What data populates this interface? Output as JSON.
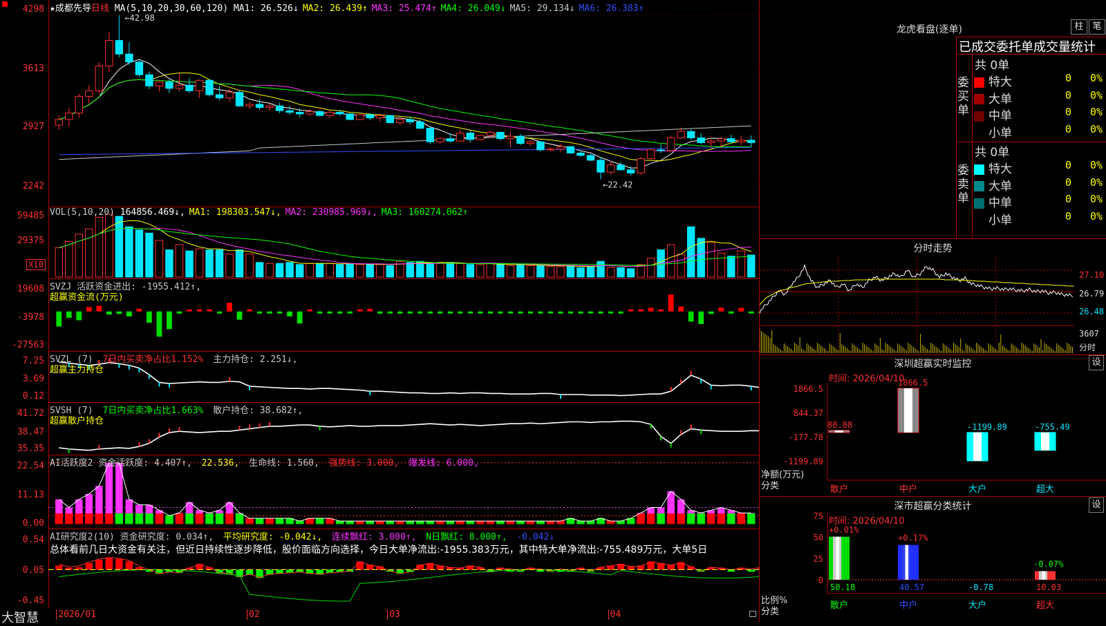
{
  "app": {
    "logo_text": "大智慧"
  },
  "main": {
    "header": {
      "star": "★",
      "stock": "成都先导",
      "period": "日线",
      "ma_label": "MA(5,10,20,30,60,120)",
      "ma": [
        {
          "label": "MA1: 26.526↓",
          "color": "#ffffff"
        },
        {
          "label": "MA2: 26.439↑",
          "color": "#ffff00"
        },
        {
          "label": "MA3: 25.474↑",
          "color": "#ff33ff"
        },
        {
          "label": "MA4: 26.049↓",
          "color": "#00ff00"
        },
        {
          "label": "MA5: 29.134↓",
          "color": "#c8c8c8"
        },
        {
          "label": "MA6: 26.383↑",
          "color": "#3050ff"
        }
      ]
    },
    "y_labels": [
      "4298",
      "3613",
      "2927",
      "2242"
    ],
    "high_label": "←42.98",
    "low_label": "←22.42",
    "candles": [
      [
        29.2,
        30.4,
        28.6,
        29.9
      ],
      [
        29.9,
        31.4,
        29.0,
        30.7
      ],
      [
        30.7,
        33.1,
        30.1,
        32.8
      ],
      [
        32.8,
        34.2,
        31.8,
        33.5
      ],
      [
        33.5,
        37.1,
        33.2,
        36.6
      ],
      [
        36.6,
        40.9,
        35.9,
        39.8
      ],
      [
        39.8,
        42.98,
        37.7,
        38.1
      ],
      [
        38.1,
        39.6,
        36.7,
        37.1
      ],
      [
        37.1,
        37.3,
        35.2,
        35.5
      ],
      [
        35.5,
        35.9,
        33.7,
        34.1
      ],
      [
        34.1,
        34.8,
        33.4,
        34.6
      ],
      [
        34.6,
        34.9,
        33.2,
        33.8
      ],
      [
        33.8,
        35.6,
        33.4,
        34.2
      ],
      [
        34.2,
        35.1,
        33.2,
        33.5
      ],
      [
        33.5,
        34.9,
        32.6,
        34.8
      ],
      [
        34.8,
        35.0,
        32.8,
        33.0
      ],
      [
        33.0,
        34.1,
        32.3,
        32.6
      ],
      [
        32.6,
        33.7,
        32.1,
        33.3
      ],
      [
        33.3,
        33.6,
        31.5,
        31.6
      ],
      [
        31.6,
        32.1,
        31.2,
        31.8
      ],
      [
        31.8,
        32.4,
        31.1,
        31.4
      ],
      [
        31.4,
        31.9,
        31.0,
        31.6
      ],
      [
        31.6,
        32.0,
        30.7,
        31.0
      ],
      [
        31.0,
        31.6,
        30.5,
        30.8
      ],
      [
        30.8,
        31.3,
        30.2,
        30.6
      ],
      [
        30.6,
        31.2,
        30.3,
        30.9
      ],
      [
        30.9,
        31.0,
        30.3,
        30.4
      ],
      [
        30.4,
        31.0,
        30.1,
        30.8
      ],
      [
        30.8,
        31.1,
        30.4,
        30.6
      ],
      [
        30.6,
        30.7,
        29.8,
        29.9
      ],
      [
        29.9,
        30.6,
        29.8,
        30.5
      ],
      [
        30.5,
        30.7,
        29.8,
        30.1
      ],
      [
        30.1,
        30.6,
        29.6,
        30.4
      ],
      [
        30.4,
        30.5,
        29.4,
        29.5
      ],
      [
        29.5,
        30.2,
        29.2,
        29.9
      ],
      [
        29.9,
        30.3,
        29.3,
        29.6
      ],
      [
        29.6,
        29.9,
        28.7,
        28.8
      ],
      [
        28.8,
        29.0,
        26.8,
        27.1
      ],
      [
        27.1,
        27.7,
        26.8,
        27.5
      ],
      [
        27.5,
        28.2,
        27.0,
        27.2
      ],
      [
        27.2,
        28.6,
        27.1,
        28.2
      ],
      [
        28.2,
        28.5,
        27.0,
        27.4
      ],
      [
        27.4,
        28.0,
        27.2,
        27.9
      ],
      [
        27.9,
        28.5,
        27.6,
        28.3
      ],
      [
        28.3,
        28.4,
        27.3,
        27.5
      ],
      [
        27.5,
        28.4,
        26.4,
        27.8
      ],
      [
        27.8,
        28.1,
        26.7,
        26.9
      ],
      [
        26.9,
        27.3,
        26.6,
        27.1
      ],
      [
        27.1,
        27.2,
        25.9,
        26.1
      ],
      [
        26.1,
        26.4,
        25.9,
        26.2
      ],
      [
        26.2,
        26.9,
        25.8,
        26.5
      ],
      [
        26.5,
        26.6,
        25.6,
        25.7
      ],
      [
        25.7,
        26.0,
        25.2,
        25.4
      ],
      [
        25.4,
        25.6,
        24.7,
        24.8
      ],
      [
        24.8,
        25.2,
        22.42,
        23.3
      ],
      [
        23.3,
        24.7,
        23.0,
        24.2
      ],
      [
        24.2,
        24.6,
        23.5,
        23.6
      ],
      [
        23.6,
        24.0,
        22.9,
        23.2
      ],
      [
        23.2,
        25.2,
        23.0,
        25.0
      ],
      [
        25.0,
        26.3,
        24.9,
        26.1
      ],
      [
        26.1,
        26.8,
        25.7,
        26.0
      ],
      [
        26.0,
        27.9,
        25.9,
        27.6
      ],
      [
        27.6,
        28.9,
        27.5,
        28.4
      ],
      [
        28.4,
        28.7,
        27.3,
        27.6
      ],
      [
        27.6,
        28.2,
        26.8,
        27.0
      ],
      [
        27.0,
        27.6,
        26.4,
        27.2
      ],
      [
        27.2,
        27.7,
        26.3,
        27.5
      ],
      [
        27.5,
        28.0,
        26.9,
        27.1
      ],
      [
        27.1,
        27.9,
        26.6,
        27.3
      ],
      [
        27.3,
        27.9,
        26.5,
        27.0
      ]
    ],
    "x_labels": [
      {
        "text": "2026/01",
        "i": 0
      },
      {
        "text": "02",
        "i": 19
      },
      {
        "text": "03",
        "i": 33
      },
      {
        "text": "04",
        "i": 55
      }
    ]
  },
  "vol": {
    "header_prefix": "VOL(5,10,20)",
    "header": [
      {
        "label": "164856.469↓,",
        "color": "#ffffff"
      },
      {
        "label": "MA1: 198303.547↓,",
        "color": "#ffff00"
      },
      {
        "label": "MA2: 230985.969↓,",
        "color": "#ff33ff"
      },
      {
        "label": "MA3: 160274.062↑",
        "color": "#00ff00"
      }
    ],
    "y_labels": [
      "59485",
      "29375"
    ],
    "unit": "X10",
    "values": [
      28,
      34,
      41,
      46,
      57,
      60,
      58,
      48,
      45,
      42,
      35,
      26,
      31,
      25,
      27,
      26,
      26,
      22,
      26,
      22,
      14,
      13,
      13,
      14,
      12,
      13,
      13,
      13,
      12,
      13,
      12,
      12,
      12,
      11,
      15,
      14,
      15,
      13,
      13,
      14,
      13,
      12,
      12,
      13,
      12,
      11,
      12,
      11,
      11,
      10,
      10,
      11,
      9,
      10,
      15,
      9,
      9,
      8,
      12,
      18,
      26,
      31,
      22,
      48,
      37,
      33,
      23,
      20,
      25,
      21
    ]
  },
  "svzj": {
    "header": [
      {
        "label": "SVZJ  活跃资金进出: -1955.412↑,",
        "color": "#c8c8c8"
      }
    ],
    "subtitle": "超赢资金流(万元)",
    "y_labels": [
      "19608",
      "-3978",
      "-27563"
    ],
    "values": [
      -12000,
      -5000,
      -7000,
      3500,
      4500,
      -2500,
      -2000,
      -4000,
      2200,
      -9000,
      -20000,
      -14000,
      -1500,
      700,
      700,
      500,
      -300,
      7000,
      -6500,
      300,
      -800,
      -1500,
      -700,
      -4000,
      -9500,
      600,
      -600,
      -300,
      -500,
      -400,
      1700,
      2000,
      -1400,
      -700,
      -1100,
      -800,
      -800,
      -600,
      -600,
      -700,
      -800,
      -600,
      -700,
      -600,
      -500,
      -700,
      -500,
      -600,
      -600,
      -400,
      -600,
      -500,
      -600,
      -400,
      -500,
      -400,
      -300,
      700,
      1600,
      2900,
      700,
      13500,
      4000,
      -8000,
      -10000,
      -2000,
      3000,
      -1500,
      2800,
      -1200,
      -1500
    ]
  },
  "svzl": {
    "header": [
      {
        "label": "SVZL (7) ",
        "color": "#c8c8c8"
      },
      {
        "label": "7日内买卖净占比1.152%",
        "color": "#ff3030"
      },
      {
        "label": " 主力持仓: 2.251↓,",
        "color": "#c8c8c8"
      }
    ],
    "subtitle": "超赢主力持仓",
    "y_labels": [
      "7.25",
      "3.69",
      "0.12"
    ],
    "values": [
      6.9,
      6.7,
      6.5,
      6.3,
      6.5,
      6.8,
      6.6,
      6.3,
      5.8,
      4.6,
      3.2,
      3.0,
      3.1,
      3.2,
      3.3,
      3.2,
      3.2,
      3.4,
      3.3,
      2.5,
      2.4,
      2.3,
      2.2,
      2.1,
      2.1,
      2.0,
      2.1,
      2.1,
      2.0,
      1.9,
      1.8,
      1.6,
      1.6,
      1.5,
      1.4,
      1.3,
      1.3,
      1.2,
      1.2,
      1.3,
      1.2,
      1.3,
      1.3,
      1.2,
      1.2,
      1.1,
      1.1,
      1.1,
      1.2,
      1.2,
      1.0,
      1.0,
      1.0,
      0.9,
      0.9,
      0.9,
      0.8,
      0.9,
      1.0,
      1.1,
      1.1,
      1.6,
      3.0,
      4.5,
      3.8,
      2.7,
      2.6,
      2.7,
      2.7,
      2.5,
      2.25
    ]
  },
  "svsh": {
    "header": [
      {
        "label": "SVSH (7) ",
        "color": "#c8c8c8"
      },
      {
        "label": "7日内买卖净占比1.663%",
        "color": "#00ff00"
      },
      {
        "label": " 散户持仓: 38.682↑,",
        "color": "#c8c8c8"
      }
    ],
    "subtitle": "超赢散户持仓",
    "y_labels": [
      "41.72",
      "38.47",
      "35.35"
    ],
    "values": [
      36.0,
      35.8,
      35.7,
      35.6,
      35.8,
      35.9,
      36.0,
      35.9,
      36.2,
      36.7,
      37.7,
      38.4,
      38.6,
      38.5,
      38.4,
      38.5,
      38.6,
      38.6,
      38.8,
      39.0,
      39.2,
      39.4,
      39.4,
      39.5,
      39.6,
      39.6,
      39.4,
      39.3,
      39.4,
      39.5,
      39.4,
      39.4,
      39.5,
      39.5,
      39.5,
      39.6,
      39.7,
      39.8,
      39.7,
      39.6,
      39.7,
      39.6,
      39.5,
      39.6,
      39.7,
      39.8,
      39.8,
      39.9,
      39.8,
      39.9,
      40.0,
      40.1,
      40.1,
      40.0,
      40.1,
      40.1,
      40.2,
      40.2,
      40.1,
      39.7,
      37.8,
      36.7,
      38.1,
      39.0,
      38.8,
      38.7,
      38.6,
      38.6,
      38.6,
      38.7,
      38.68
    ]
  },
  "ai_active": {
    "header": [
      {
        "label": "AI活跃度2 资金活跃度: 4.407↑,",
        "color": "#c8c8c8"
      },
      {
        "label": " 22.536,",
        "color": "#ffff00"
      },
      {
        "label": " 生命线: 1.560,",
        "color": "#c8c8c8"
      },
      {
        "label": " 强势线: 3.000,",
        "color": "#ff3030"
      },
      {
        "label": " 爆发线: 6.000,",
        "color": "#ff33ff"
      }
    ],
    "y_labels": [
      "22.54",
      "11.13",
      "0.00"
    ],
    "values": [
      9,
      6,
      9,
      11,
      14,
      22.5,
      22.5,
      9,
      7,
      7,
      5,
      3,
      4,
      8,
      5,
      4,
      5,
      8,
      4,
      2,
      2,
      2,
      2,
      2,
      1,
      2,
      2,
      2,
      1,
      1,
      1,
      1,
      1,
      1,
      1,
      1,
      1,
      1,
      1,
      1,
      1,
      1,
      1,
      1,
      1,
      1,
      1,
      1,
      1,
      1,
      1,
      2,
      1,
      1,
      2,
      1,
      1,
      2,
      4,
      6,
      6,
      12,
      9,
      5,
      4,
      5,
      6,
      5,
      4,
      4
    ]
  },
  "ai_research": {
    "header": [
      {
        "label": "AI研究度2(10) 资金研究度: 0.034↑,",
        "color": "#c8c8c8"
      },
      {
        "label": " 平均研究度: -0.042↓,",
        "color": "#ffff00"
      },
      {
        "label": " 连续飘红: 3.000↑,",
        "color": "#ff33ff"
      },
      {
        "label": " N日飘红: 8.000↑,",
        "color": "#00ff00"
      },
      {
        "label": " -0.042↓",
        "color": "#3050ff"
      }
    ],
    "commentary": "总体看前几日大资金有关注，但近日持续性逐步降低，股价面临方向选择，今日大单净流出:-1955.383万元，其中特大单净流出:-755.489万元，大单5日",
    "y_labels": [
      "0.54",
      "0.05",
      "-0.45"
    ],
    "values": [
      0.05,
      0.02,
      0.03,
      0.08,
      0.12,
      0.14,
      0.13,
      0.1,
      0.03,
      -0.02,
      -0.05,
      -0.03,
      -0.04,
      0.02,
      0.07,
      0.03,
      -0.04,
      -0.05,
      -0.09,
      -0.06,
      -0.1,
      -0.06,
      -0.05,
      -0.04,
      -0.03,
      -0.05,
      -0.06,
      -0.04,
      -0.03,
      -0.02,
      0.1,
      0.06,
      0.04,
      -0.02,
      -0.05,
      -0.03,
      0.06,
      0.08,
      0.05,
      0.03,
      0.02,
      0.05,
      0.03,
      -0.03,
      0.02,
      0.01,
      -0.01,
      0.02,
      0.01,
      -0.02,
      0.01,
      -0.01,
      0.02,
      -0.02,
      0.03,
      0.05,
      0.07,
      0.04,
      0.05,
      0.1,
      0.08,
      0.06,
      0.09,
      0.04,
      -0.02,
      0.03,
      0.02,
      0.0,
      0.02,
      0.01,
      0.03
    ]
  },
  "right": {
    "dragon": {
      "title": "龙虎看盘(逐单)",
      "btn1": "柱",
      "btn2": "笔",
      "subtitle": "已成交委托单成交量统计",
      "buy_side": "委买单",
      "sell_side": "委卖单",
      "buy_total": "共 0单",
      "sell_total": "共 0单",
      "buy_rows": [
        {
          "label": "特大",
          "val": "0",
          "pct": "0%",
          "color": "#ff0000"
        },
        {
          "label": "大单",
          "val": "0",
          "pct": "0%",
          "color": "#a00000"
        },
        {
          "label": "中单",
          "val": "0",
          "pct": "0%",
          "color": "#700000"
        },
        {
          "label": "小单",
          "val": "0",
          "pct": "0%",
          "color": ""
        }
      ],
      "sell_rows": [
        {
          "label": "特大",
          "val": "0",
          "pct": "0%",
          "color": "#00ffff"
        },
        {
          "label": "大单",
          "val": "0",
          "pct": "0%",
          "color": "#008b8b"
        },
        {
          "label": "中单",
          "val": "0",
          "pct": "0%",
          "color": "#007070"
        },
        {
          "label": "小单",
          "val": "0",
          "pct": "0%",
          "color": ""
        }
      ]
    },
    "intraday": {
      "title": "分时走势",
      "y_labels": [
        "27.10",
        "26.79",
        "26.48"
      ],
      "vol_label": "3607",
      "vol_unit": "分时",
      "price": [
        26.5,
        26.6,
        26.7,
        26.8,
        26.75,
        26.9,
        27.0,
        27.15,
        26.95,
        26.85,
        26.9,
        26.95,
        26.85,
        26.9,
        26.8,
        26.9,
        26.85,
        26.95,
        27.0,
        26.95,
        27.0,
        27.05,
        27.0,
        27.1,
        27.0,
        27.05,
        27.15,
        27.1,
        27.0,
        27.05,
        27.0,
        26.95,
        26.98,
        26.9,
        26.88,
        26.85,
        26.83,
        26.84,
        26.82,
        26.83,
        26.81,
        26.8,
        26.82,
        26.79,
        26.8,
        26.77,
        26.78,
        26.75,
        26.74,
        26.73
      ],
      "avg": [
        26.6,
        26.7,
        26.75,
        26.8,
        26.82,
        26.85,
        26.87,
        26.9,
        26.91,
        26.92,
        26.93,
        26.94,
        26.94,
        26.95,
        26.95,
        26.96,
        26.96,
        26.96,
        26.97,
        26.97,
        26.97,
        26.97,
        26.97,
        26.97,
        26.97,
        26.97,
        26.97,
        26.97,
        26.97,
        26.96,
        26.96,
        26.96,
        26.95,
        26.95,
        26.94,
        26.94,
        26.93,
        26.93,
        26.92,
        26.92,
        26.91,
        26.91,
        26.9,
        26.9,
        26.89,
        26.89,
        26.88,
        26.88,
        26.87,
        26.87
      ]
    },
    "sz_monitor": {
      "title": "深圳超赢实时监控",
      "btn": "设",
      "date": "时间: 2026/04/10",
      "y_labels": [
        "1866.5",
        "844.37",
        "-177.78",
        "-1199.89"
      ],
      "ylabel": "净额(万元)",
      "cat_label": "分类",
      "chart_data": {
        "type": "bar",
        "categories": [
          "散户",
          "中户",
          "大户",
          "超大"
        ],
        "values": [
          88.88,
          1866.5,
          -1199.89,
          -755.49
        ],
        "labels": [
          "88.88",
          "1866.5",
          "-1199.89",
          "-755.49"
        ],
        "colors": [
          "#ff3030",
          "#ff3030",
          "#00ffff",
          "#00ffff"
        ],
        "ylim": [
          -1199.89,
          1866.5
        ]
      }
    },
    "sz_class": {
      "title": "深市超赢分类统计",
      "btn": "设",
      "date": "时间: 2026/04/10",
      "y_labels": [
        "75",
        "50",
        "25",
        "0"
      ],
      "ylabel": "比例%",
      "cat_label": "分类",
      "chart_data": {
        "type": "bar",
        "categories": [
          "散户",
          "中户",
          "大户",
          "超大"
        ],
        "values": [
          50.18,
          40.57,
          -0.78,
          10.03
        ],
        "change_labels": [
          "+0.01%",
          "+0.17%",
          "",
          "-0.07%"
        ],
        "value_labels": [
          "50.18",
          "40.57",
          "-0.78",
          "10.03"
        ],
        "ylim": [
          0,
          75
        ]
      }
    }
  }
}
